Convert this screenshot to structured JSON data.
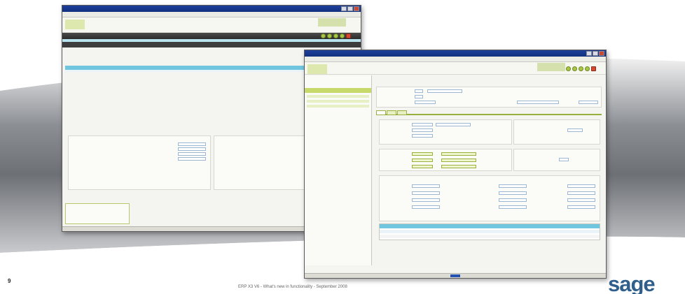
{
  "slide": {
    "page_number": "9",
    "footer_text": "ERP X3 V6 - What's new in functionality - September 2008",
    "brand_logo": "sage"
  },
  "colors": {
    "title_bar": "#1e3f9c",
    "accent_green": "#a9c54a",
    "grid_header": "#6fc6de",
    "brand_blue": "#2f5f8a"
  },
  "back_window": {
    "icons": [
      "app-logo-icon",
      "nav-circle-icon",
      "nav-circle-icon",
      "nav-circle-icon",
      "nav-circle-icon",
      "close-icon"
    ]
  },
  "front_window": {
    "icons": [
      "app-logo-icon",
      "nav-circle-icon",
      "nav-circle-icon",
      "nav-circle-icon",
      "nav-circle-icon",
      "close-icon"
    ],
    "tabs": [
      "",
      "",
      ""
    ]
  }
}
